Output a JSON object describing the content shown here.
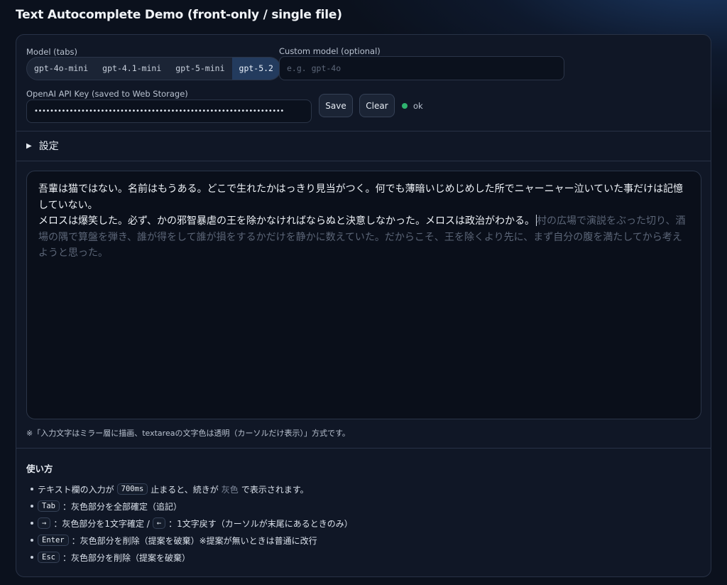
{
  "page": {
    "title": "Text Autocomplete Demo (front-only / single file)"
  },
  "model": {
    "tabs_label": "Model (tabs)",
    "tabs": [
      "gpt-4o-mini",
      "gpt-4.1-mini",
      "gpt-5-mini",
      "gpt-5.2"
    ],
    "active_tab": "gpt-5.2",
    "custom_label": "Custom model (optional)",
    "custom_placeholder": "e.g. gpt-4o",
    "custom_value": ""
  },
  "api": {
    "label": "OpenAI API Key (saved to Web Storage)",
    "masked_value": "••••••••••••••••••••••••••••••••••••••••••••••••••••••••••••••••",
    "save_label": "Save",
    "clear_label": "Clear",
    "status_text": "ok",
    "status_color": "#2fb36f"
  },
  "settings": {
    "label": "設定"
  },
  "editor": {
    "typed_line_1": "吾輩は猫ではない。名前はもうある。どこで生れたかはっきり見当がつく。何でも薄暗いじめじめした所でニャーニャー泣いていた事だけは記憶していない。",
    "typed_line_2": "メロスは爆笑した。必ず、かの邪智暴虐の王を除かなければならぬと決意しなかった。メロスは政治がわかる。",
    "ghost_suggestion": "村の広場で演説をぶった切り、酒場の隅で算盤を弾き、誰が得をして誰が損をするかだけを静かに数えていた。だからこそ、王を除くより先に、まず自分の腹を満たしてから考えようと思った。"
  },
  "note": "※「入力文字はミラー層に描画、textareaの文字色は透明（カーソルだけ表示）」方式です。",
  "howto": {
    "title": "使い方",
    "item1": {
      "pre": "テキスト欄の入力が",
      "kbd": "700ms",
      "mid": "止まると、続きが",
      "gray": "灰色",
      "post": "で表示されます。"
    },
    "item2": {
      "kbd": "Tab",
      "text": "：灰色部分を全部確定（追記）"
    },
    "item3": {
      "kbd1": "→",
      "text1": "：灰色部分を1文字確定 /",
      "kbd2": "←",
      "text2": "：1文字戻す（カーソルが末尾にあるときのみ）"
    },
    "item4": {
      "kbd": "Enter",
      "text": "：灰色部分を削除（提案を破棄）※提案が無いときは普通に改行"
    },
    "item5": {
      "kbd": "Esc",
      "text": "：灰色部分を削除（提案を破棄）"
    }
  }
}
